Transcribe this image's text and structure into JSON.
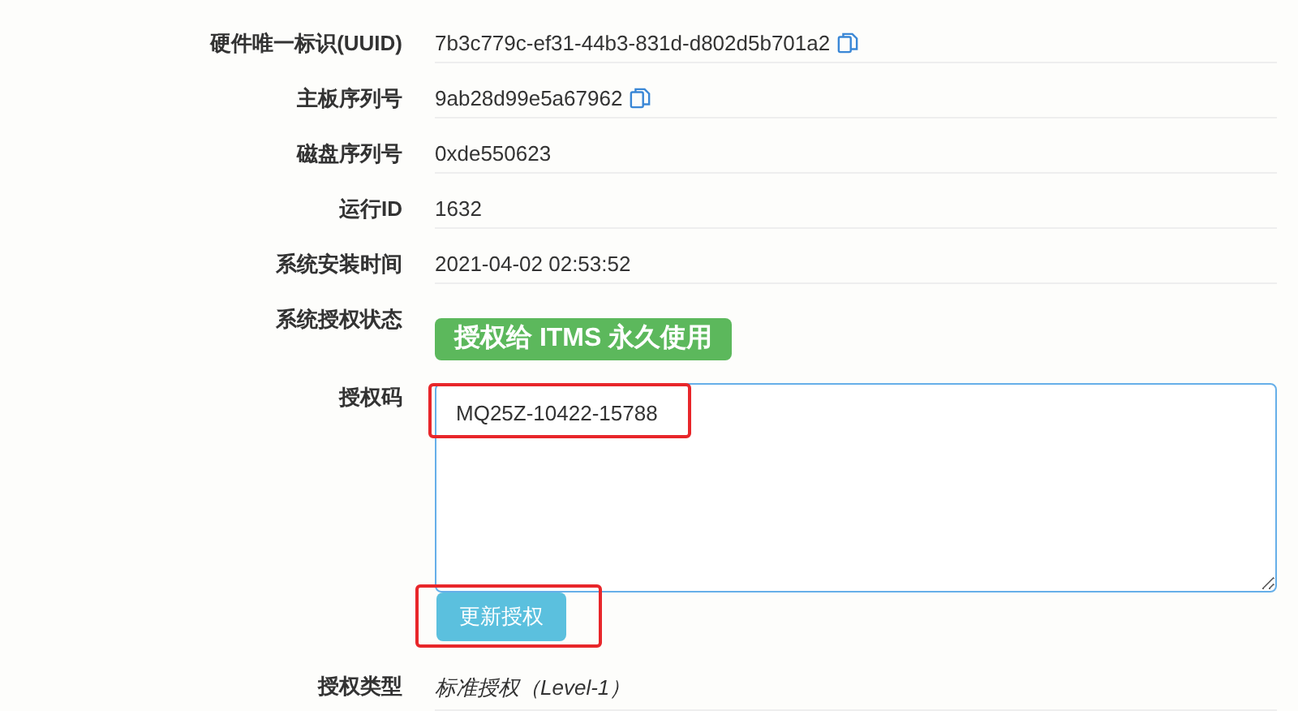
{
  "fields": [
    {
      "label": "硬件唯一标识(UUID)",
      "value": "7b3c779c-ef31-44b3-831d-d802d5b701a2",
      "copyable": true
    },
    {
      "label": "主板序列号",
      "value": "9ab28d99e5a67962",
      "copyable": true
    },
    {
      "label": "磁盘序列号",
      "value": "0xde550623",
      "copyable": false
    },
    {
      "label": "运行ID",
      "value": "1632",
      "copyable": false
    },
    {
      "label": "系统安装时间",
      "value": "2021-04-02 02:53:52",
      "copyable": false
    }
  ],
  "status": {
    "label": "系统授权状态",
    "badge": "授权给 ITMS 永久使用"
  },
  "license_code": {
    "label": "授权码",
    "value": "MQ25Z-10422-15788",
    "highlighted": true
  },
  "update_button": {
    "label": "更新授权",
    "highlighted": true
  },
  "license_type": {
    "label": "授权类型",
    "value": "标准授权（Level-1）"
  }
}
